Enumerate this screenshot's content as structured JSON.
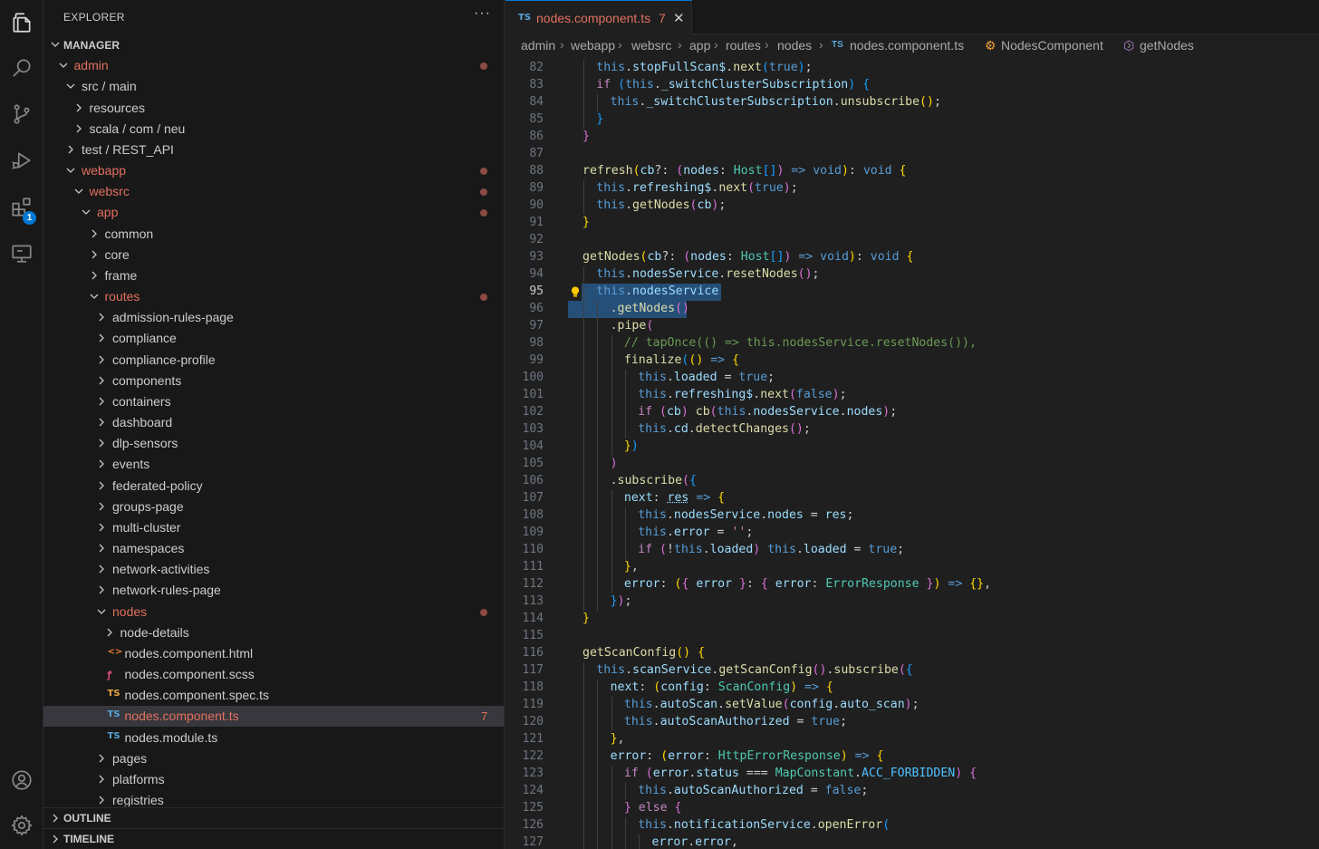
{
  "activity_bar": {
    "items": [
      {
        "name": "explorer-icon"
      },
      {
        "name": "search-icon"
      },
      {
        "name": "source-control-icon"
      },
      {
        "name": "run-debug-icon"
      },
      {
        "name": "extensions-icon",
        "badge": "1"
      },
      {
        "name": "remote-explorer-icon"
      }
    ],
    "bottom": [
      {
        "name": "account-icon"
      },
      {
        "name": "settings-gear-icon"
      }
    ]
  },
  "sidebar": {
    "title": "EXPLORER",
    "more": "···",
    "tree": [
      {
        "label": "MANAGER",
        "depth": 0,
        "type": "section",
        "open": true
      },
      {
        "label": "admin",
        "depth": 1,
        "open": true,
        "modified": true
      },
      {
        "label": "src / main",
        "depth": 2,
        "open": true
      },
      {
        "label": "resources",
        "depth": 3,
        "open": false
      },
      {
        "label": "scala / com / neu",
        "depth": 3,
        "open": false
      },
      {
        "label": "test / REST_API",
        "depth": 2,
        "open": false
      },
      {
        "label": "webapp",
        "depth": 2,
        "open": true,
        "modified": true
      },
      {
        "label": "websrc",
        "depth": 3,
        "open": true,
        "modified": true
      },
      {
        "label": "app",
        "depth": 4,
        "open": true,
        "modified": true
      },
      {
        "label": "common",
        "depth": 5,
        "open": false
      },
      {
        "label": "core",
        "depth": 5,
        "open": false
      },
      {
        "label": "frame",
        "depth": 5,
        "open": false
      },
      {
        "label": "routes",
        "depth": 5,
        "open": true,
        "modified": true
      },
      {
        "label": "admission-rules-page",
        "depth": 6,
        "open": false
      },
      {
        "label": "compliance",
        "depth": 6,
        "open": false
      },
      {
        "label": "compliance-profile",
        "depth": 6,
        "open": false
      },
      {
        "label": "components",
        "depth": 6,
        "open": false
      },
      {
        "label": "containers",
        "depth": 6,
        "open": false
      },
      {
        "label": "dashboard",
        "depth": 6,
        "open": false
      },
      {
        "label": "dlp-sensors",
        "depth": 6,
        "open": false
      },
      {
        "label": "events",
        "depth": 6,
        "open": false
      },
      {
        "label": "federated-policy",
        "depth": 6,
        "open": false
      },
      {
        "label": "groups-page",
        "depth": 6,
        "open": false
      },
      {
        "label": "multi-cluster",
        "depth": 6,
        "open": false
      },
      {
        "label": "namespaces",
        "depth": 6,
        "open": false
      },
      {
        "label": "network-activities",
        "depth": 6,
        "open": false
      },
      {
        "label": "network-rules-page",
        "depth": 6,
        "open": false
      },
      {
        "label": "nodes",
        "depth": 6,
        "open": true,
        "modified": true
      },
      {
        "label": "node-details",
        "depth": 7,
        "open": false
      },
      {
        "label": "nodes.component.html",
        "depth": 7,
        "type": "file",
        "icon": "<>",
        "icon_color": "#e37933"
      },
      {
        "label": "nodes.component.scss",
        "depth": 7,
        "type": "file",
        "icon": "ꝭ",
        "icon_color": "#f55385"
      },
      {
        "label": "nodes.component.spec.ts",
        "depth": 7,
        "type": "file",
        "icon": "TS",
        "icon_color": "#e8a33d"
      },
      {
        "label": "nodes.component.ts",
        "depth": 7,
        "type": "file",
        "icon": "TS",
        "icon_color": "#5aa4d8",
        "selected": true,
        "modified": true,
        "count": "7"
      },
      {
        "label": "nodes.module.ts",
        "depth": 7,
        "type": "file",
        "icon": "TS",
        "icon_color": "#5aa4d8"
      },
      {
        "label": "pages",
        "depth": 6,
        "open": false
      },
      {
        "label": "platforms",
        "depth": 6,
        "open": false
      },
      {
        "label": "registries",
        "depth": 6,
        "open": false
      }
    ],
    "outline_label": "OUTLINE",
    "timeline_label": "TIMELINE"
  },
  "editor": {
    "tab": {
      "icon": "TS",
      "label": "nodes.component.ts",
      "problems": "7",
      "close": "✕"
    },
    "breadcrumbs": [
      "admin",
      "webapp",
      "websrc",
      "app",
      "routes",
      "nodes",
      "nodes.component.ts",
      "NodesComponent",
      "getNodes"
    ],
    "current_line": "95",
    "lines": [
      {
        "n": "82",
        "indent": 1,
        "html": "<span class='th'>this</span>.<span class='p'>stopFullScan$</span>.<span class='f'>next</span><span class='b3'>(</span><span class='kb'>true</span><span class='b3'>)</span>;"
      },
      {
        "n": "83",
        "indent": 1,
        "html": "<span class='k'>if</span> <span class='b3'>(</span><span class='th'>this</span>.<span class='p'>_switchClusterSubscription</span><span class='b3'>)</span> <span class='b3'>{</span>"
      },
      {
        "n": "84",
        "indent": 2,
        "html": "<span class='th'>this</span>.<span class='p'>_switchClusterSubscription</span>.<span class='f'>unsubscribe</span><span class='b1'>()</span>;"
      },
      {
        "n": "85",
        "indent": 1,
        "html": "<span class='b3'>}</span>"
      },
      {
        "n": "86",
        "indent": 0,
        "html": "<span class='b2'>}</span>"
      },
      {
        "n": "87",
        "indent": 0,
        "html": ""
      },
      {
        "n": "88",
        "indent": 0,
        "html": "<span class='f'>refresh</span><span class='b1'>(</span><span class='p'>cb</span>?: <span class='b2'>(</span><span class='p'>nodes</span>: <span class='t'>Host</span><span class='b3'>[]</span><span class='b2'>)</span> <span class='kb'>=&gt;</span> <span class='kb'>void</span><span class='b1'>)</span>: <span class='kb'>void</span> <span class='b1'>{</span>"
      },
      {
        "n": "89",
        "indent": 1,
        "html": "<span class='th'>this</span>.<span class='p'>refreshing$</span>.<span class='f'>next</span><span class='b2'>(</span><span class='kb'>true</span><span class='b2'>)</span>;"
      },
      {
        "n": "90",
        "indent": 1,
        "html": "<span class='th'>this</span>.<span class='f'>getNodes</span><span class='b2'>(</span><span class='p'>cb</span><span class='b2'>)</span>;"
      },
      {
        "n": "91",
        "indent": 0,
        "html": "<span class='b1'>}</span>"
      },
      {
        "n": "92",
        "indent": 0,
        "html": ""
      },
      {
        "n": "93",
        "indent": 0,
        "html": "<span class='f'>getNodes</span><span class='b1'>(</span><span class='p'>cb</span>?: <span class='b2'>(</span><span class='p'>nodes</span>: <span class='t'>Host</span><span class='b3'>[]</span><span class='b2'>)</span> <span class='kb'>=&gt;</span> <span class='kb'>void</span><span class='b1'>)</span>: <span class='kb'>void</span> <span class='b1'>{</span>"
      },
      {
        "n": "94",
        "indent": 1,
        "html": "<span class='th'>this</span>.<span class='p'>nodesService</span>.<span class='f'>resetNodes</span><span class='b2'>()</span>;"
      },
      {
        "n": "95",
        "indent": 1,
        "html": "<span class='th'>this</span>.<span class='p'>nodesService</span>",
        "sel": [
          84,
          238
        ],
        "bulb": true
      },
      {
        "n": "96",
        "indent": 2,
        "html": ".<span class='f'>getNodes</span><span class='b2'>()</span>",
        "sel": [
          69,
          200
        ]
      },
      {
        "n": "97",
        "indent": 2,
        "html": ".<span class='f'>pipe</span><span class='b2'>(</span>"
      },
      {
        "n": "98",
        "indent": 3,
        "html": "<span class='c'>// tapOnce(() =&gt; this.nodesService.resetNodes()),</span>"
      },
      {
        "n": "99",
        "indent": 3,
        "html": "<span class='f'>finalize</span><span class='b3'>(</span><span class='b1'>()</span> <span class='kb'>=&gt;</span> <span class='b1'>{</span>"
      },
      {
        "n": "100",
        "indent": 4,
        "html": "<span class='th'>this</span>.<span class='p'>loaded</span> = <span class='kb'>true</span>;"
      },
      {
        "n": "101",
        "indent": 4,
        "html": "<span class='th'>this</span>.<span class='p'>refreshing$</span>.<span class='f'>next</span><span class='b2'>(</span><span class='kb'>false</span><span class='b2'>)</span>;"
      },
      {
        "n": "102",
        "indent": 4,
        "html": "<span class='k'>if</span> <span class='b2'>(</span><span class='p'>cb</span><span class='b2'>)</span> <span class='f'>cb</span><span class='b2'>(</span><span class='th'>this</span>.<span class='p'>nodesService</span>.<span class='p'>nodes</span><span class='b2'>)</span>;"
      },
      {
        "n": "103",
        "indent": 4,
        "html": "<span class='th'>this</span>.<span class='p'>cd</span>.<span class='f'>detectChanges</span><span class='b2'>()</span>;"
      },
      {
        "n": "104",
        "indent": 3,
        "html": "<span class='b1'>}</span><span class='b3'>)</span>"
      },
      {
        "n": "105",
        "indent": 2,
        "html": "<span class='b2'>)</span>"
      },
      {
        "n": "106",
        "indent": 2,
        "html": ".<span class='f'>subscribe</span><span class='b2'>(</span><span class='b3'>{</span>"
      },
      {
        "n": "107",
        "indent": 3,
        "html": "<span class='p'>next</span>: <span class='p' style='text-decoration: underline dotted;'>res</span> <span class='kb'>=&gt;</span> <span class='b1'>{</span>"
      },
      {
        "n": "108",
        "indent": 4,
        "html": "<span class='th'>this</span>.<span class='p'>nodesService</span>.<span class='p'>nodes</span> = <span class='p'>res</span>;"
      },
      {
        "n": "109",
        "indent": 4,
        "html": "<span class='th'>this</span>.<span class='p'>error</span> = <span class='s'>''</span>;"
      },
      {
        "n": "110",
        "indent": 4,
        "html": "<span class='k'>if</span> <span class='b2'>(</span>!<span class='th'>this</span>.<span class='p'>loaded</span><span class='b2'>)</span> <span class='th'>this</span>.<span class='p'>loaded</span> = <span class='kb'>true</span>;"
      },
      {
        "n": "111",
        "indent": 3,
        "html": "<span class='b1'>}</span>,"
      },
      {
        "n": "112",
        "indent": 3,
        "html": "<span class='p'>error</span>: <span class='b1'>(</span><span class='b2'>{</span> <span class='p'>error</span> <span class='b2'>}</span>: <span class='b2'>{</span> <span class='p'>error</span>: <span class='t'>ErrorResponse</span> <span class='b2'>}</span><span class='b1'>)</span> <span class='kb'>=&gt;</span> <span class='b1'>{}</span>,"
      },
      {
        "n": "113",
        "indent": 2,
        "html": "<span class='b3'>}</span><span class='b2'>)</span>;"
      },
      {
        "n": "114",
        "indent": 0,
        "html": "<span class='b1'>}</span>"
      },
      {
        "n": "115",
        "indent": 0,
        "html": ""
      },
      {
        "n": "116",
        "indent": 0,
        "html": "<span class='f'>getScanConfig</span><span class='b1'>()</span> <span class='b1'>{</span>"
      },
      {
        "n": "117",
        "indent": 1,
        "html": "<span class='th'>this</span>.<span class='p'>scanService</span>.<span class='f'>getScanConfig</span><span class='b2'>()</span>.<span class='f'>subscribe</span><span class='b2'>(</span><span class='b3'>{</span>"
      },
      {
        "n": "118",
        "indent": 2,
        "html": "<span class='p'>next</span>: <span class='b1'>(</span><span class='p'>config</span>: <span class='t'>ScanConfig</span><span class='b1'>)</span> <span class='kb'>=&gt;</span> <span class='b1'>{</span>"
      },
      {
        "n": "119",
        "indent": 3,
        "html": "<span class='th'>this</span>.<span class='p'>autoScan</span>.<span class='f'>setValue</span><span class='b2'>(</span><span class='p'>config</span>.<span class='p'>auto_scan</span><span class='b2'>)</span>;"
      },
      {
        "n": "120",
        "indent": 3,
        "html": "<span class='th'>this</span>.<span class='p'>autoScanAuthorized</span> = <span class='kb'>true</span>;"
      },
      {
        "n": "121",
        "indent": 2,
        "html": "<span class='b1'>}</span>,"
      },
      {
        "n": "122",
        "indent": 2,
        "html": "<span class='p'>error</span>: <span class='b1'>(</span><span class='p'>error</span>: <span class='t'>HttpErrorResponse</span><span class='b1'>)</span> <span class='kb'>=&gt;</span> <span class='b1'>{</span>"
      },
      {
        "n": "123",
        "indent": 3,
        "html": "<span class='k'>if</span> <span class='b2'>(</span><span class='p'>error</span>.<span class='p'>status</span> === <span class='t'>MapConstant</span>.<span class='cst'>ACC_FORBIDDEN</span><span class='b2'>)</span> <span class='b2'>{</span>"
      },
      {
        "n": "124",
        "indent": 4,
        "html": "<span class='th'>this</span>.<span class='p'>autoScanAuthorized</span> = <span class='kb'>false</span>;"
      },
      {
        "n": "125",
        "indent": 3,
        "html": "<span class='b2'>}</span> <span class='k'>else</span> <span class='b2'>{</span>"
      },
      {
        "n": "126",
        "indent": 4,
        "html": "<span class='th'>this</span>.<span class='p'>notificationService</span>.<span class='f'>openError</span><span class='b3'>(</span>"
      },
      {
        "n": "127",
        "indent": 5,
        "html": "<span class='p'>error</span>.<span class='p'>error</span>,"
      }
    ]
  }
}
